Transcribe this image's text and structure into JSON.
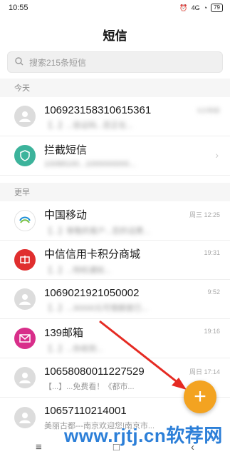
{
  "statusbar": {
    "time": "10:55",
    "signal": "4G",
    "battery": "79"
  },
  "app": {
    "title": "短信"
  },
  "search": {
    "placeholder": "搜索215条短信"
  },
  "sections": {
    "today": "今天",
    "earlier": "更早"
  },
  "messages_today": [
    {
      "name": "106923158310615361",
      "preview": "【...】...验证码...您正在...",
      "time": "5分钟前",
      "avatar": "person-icon"
    },
    {
      "name": "拦截短信",
      "preview": "10088100...1000000000...",
      "time": "",
      "avatar": "shield-icon"
    }
  ],
  "messages_earlier": [
    {
      "name": "中国移动",
      "preview": "【...】尊敬的客户...您的话费...",
      "time": "周三 12:25",
      "avatar": "china-mobile-icon"
    },
    {
      "name": "中信信用卡积分商城",
      "preview": "【...】...特权通知...",
      "time": "19:31",
      "avatar": "citic-icon"
    },
    {
      "name": "1069021921050002",
      "preview": "【...】...30000元可借额度已...",
      "time": "9:52",
      "avatar": "person-icon"
    },
    {
      "name": "139邮箱",
      "preview": "【...】...你收到...",
      "time": "19:16",
      "avatar": "mail-icon"
    },
    {
      "name": "10658080011227529",
      "preview": "【...】...免费看！《都市...",
      "time": "周日 17:14",
      "avatar": "person-icon"
    },
    {
      "name": "10657110214001",
      "preview": "美丽古都---南京欢迎您|南京市...",
      "time": "",
      "avatar": "person-icon"
    }
  ],
  "fab": {
    "label": "+"
  },
  "navbar": {
    "menu": "≡",
    "home": "□",
    "back": "‹"
  },
  "watermark": {
    "text": "www.rjtj.cn软荐网"
  },
  "colors": {
    "fab": "#f3a321",
    "watermark": "#2c7fd8",
    "arrow": "#e52a22"
  }
}
